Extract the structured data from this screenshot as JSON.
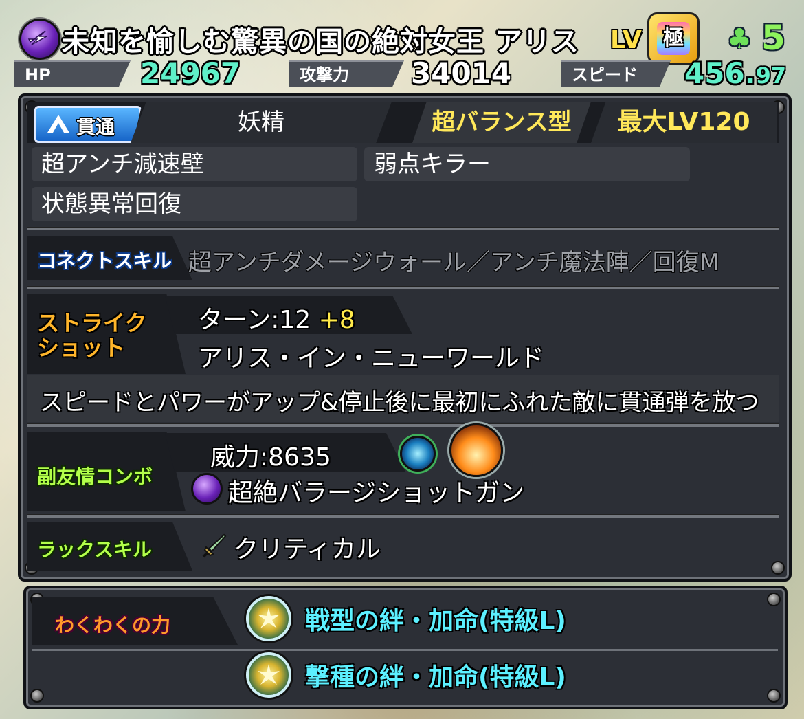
{
  "header": {
    "monster_name": "未知を愉しむ驚異の国の絶対女王 アリス",
    "level_label": "LV",
    "level_badge": "極",
    "luck_value": "5",
    "element_icon": "dark-element-icon",
    "clover_icon": "clover-icon"
  },
  "stats": {
    "hp_label": "HP",
    "hp_value": "24967",
    "atk_label": "攻撃力",
    "atk_value": "34014",
    "speed_label": "スピード",
    "speed_value_int": "456.",
    "speed_value_dec": "97"
  },
  "type_row": {
    "gimmick_badge": "貫通",
    "race": "妖精",
    "battle_type": "超バランス型",
    "max_level": "最大LV120"
  },
  "abilities": [
    "超アンチ減速壁",
    "弱点キラー",
    "状態異常回復"
  ],
  "connect_skill": {
    "label": "コネクトスキル",
    "text": "超アンチダメージウォール／アンチ魔法陣／回復M"
  },
  "strike_shot": {
    "label_line1": "ストライク",
    "label_line2": "ショット",
    "turn_text": "ターン:12",
    "turn_plus": "+8",
    "name": "アリス・イン・ニューワールド",
    "description": "スピードとパワーがアップ&停止後に最初にふれた敵に貫通弾を放つ"
  },
  "sub_combo": {
    "label": "副友情コンボ",
    "power": "威力:8635",
    "name": "超絶バラージショットガン"
  },
  "luck_skill": {
    "label": "ラックスキル",
    "name": "クリティカル"
  },
  "waku": {
    "label": "わくわくの力",
    "items": [
      "戦型の絆・加命(特級L)",
      "撃種の絆・加命(特級L)"
    ]
  },
  "colors": {
    "hp": "#5ff0c9",
    "accent_yellow": "#ffe85a",
    "waku_text": "#5cf0ff",
    "panel_bg": "#2c2f36"
  }
}
